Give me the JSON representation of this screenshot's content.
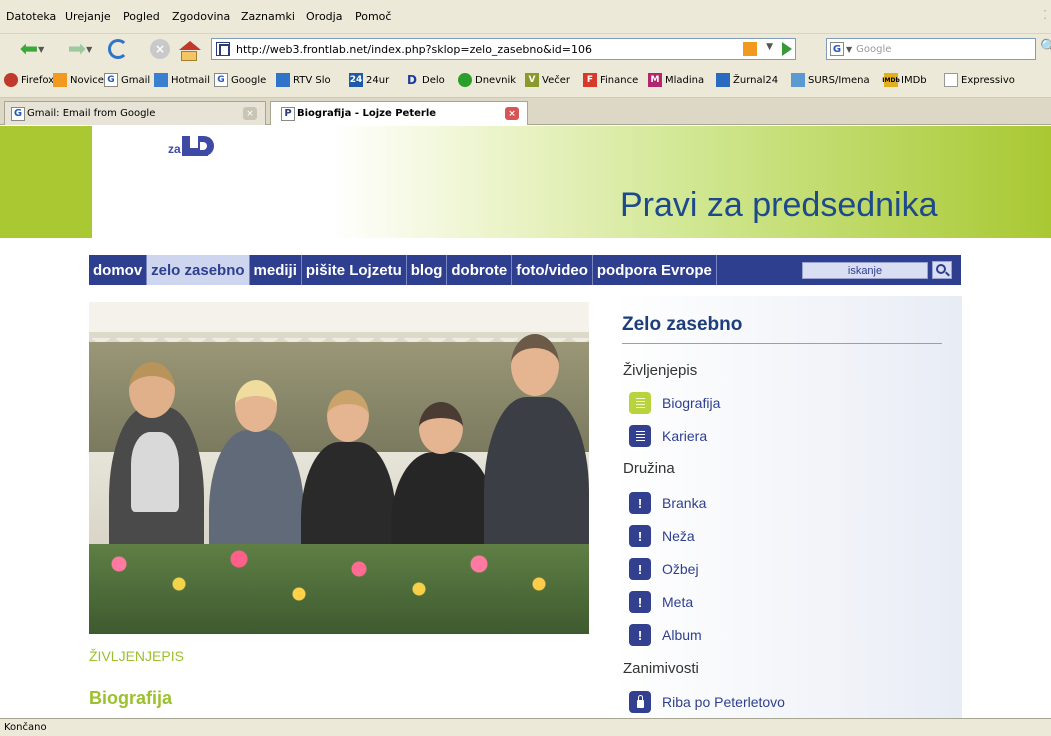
{
  "browser": {
    "menu": [
      "Datoteka",
      "Urejanje",
      "Pogled",
      "Zgodovina",
      "Zaznamki",
      "Orodja",
      "Pomoč"
    ],
    "url": "http://web3.frontlab.net/index.php?sklop=zelo_zasebno&id=106",
    "search_placeholder": "Google",
    "search_engine_icon": "G",
    "bookmarks": [
      {
        "label": "Firefox",
        "icon": "firefox-icon",
        "color": "#c0392b"
      },
      {
        "label": "Novice",
        "icon": "rss-icon",
        "color": "#f29a1f"
      },
      {
        "label": "Gmail",
        "icon": "google-icon",
        "color": "#2559b8"
      },
      {
        "label": "Hotmail",
        "icon": "msn-icon",
        "color": "#3a80d0"
      },
      {
        "label": "Google",
        "icon": "google-icon",
        "color": "#2559b8"
      },
      {
        "label": "RTV Slo",
        "icon": "rtv-icon",
        "color": "#2f74c8"
      },
      {
        "label": "24ur",
        "icon": "24ur-icon",
        "color": "#1e5aa8"
      },
      {
        "label": "Delo",
        "icon": "delo-icon",
        "color": "#1e3aa0"
      },
      {
        "label": "Dnevnik",
        "icon": "dnevnik-icon",
        "color": "#2aa02a"
      },
      {
        "label": "Večer",
        "icon": "vecer-icon",
        "color": "#8a9a2a"
      },
      {
        "label": "Finance",
        "icon": "finance-icon",
        "color": "#d83a2a"
      },
      {
        "label": "Mladina",
        "icon": "mladina-icon",
        "color": "#b3266e"
      },
      {
        "label": "Žurnal24",
        "icon": "zurnal-icon",
        "color": "#2a6ac0"
      },
      {
        "label": "SURS/Imena",
        "icon": "surs-icon",
        "color": "#5a9ad0"
      },
      {
        "label": "IMDb",
        "icon": "imdb-icon",
        "color": "#e0b020"
      },
      {
        "label": "Expressivo",
        "icon": "page-icon",
        "color": "#dddddd"
      }
    ],
    "tabs": [
      {
        "label": "Gmail: Email from Google",
        "icon": "G"
      },
      {
        "label": "Biografija - Lojze Peterle",
        "icon": "P"
      }
    ],
    "status": "Končano"
  },
  "site": {
    "logo_text": "za",
    "slogan": "Pravi za predsednika",
    "nav": [
      "domov",
      "zelo zasebno",
      "mediji",
      "pišite Lojzetu",
      "blog",
      "dobrote",
      "foto/video",
      "podpora Evrope"
    ],
    "nav_active": "zelo zasebno",
    "search_label": "iskanje",
    "breadcrumb": "ŽIVLJENJEPIS",
    "article_title": "Biografija",
    "colors": {
      "green": "#a9c832",
      "navy": "#2e3f8f",
      "title_blue": "#1e3d7b"
    }
  },
  "sidebar": {
    "title": "Zelo zasebno",
    "sections": [
      {
        "heading": "Življenjepis",
        "items": [
          {
            "label": "Biografija",
            "icon": "document-icon",
            "style": "green"
          },
          {
            "label": "Kariera",
            "icon": "document-icon",
            "style": "blue"
          }
        ]
      },
      {
        "heading": "Družina",
        "items": [
          {
            "label": "Branka",
            "icon": "exclamation-icon",
            "style": "blue"
          },
          {
            "label": "Neža",
            "icon": "exclamation-icon",
            "style": "blue"
          },
          {
            "label": "Ožbej",
            "icon": "exclamation-icon",
            "style": "blue"
          },
          {
            "label": "Meta",
            "icon": "exclamation-icon",
            "style": "blue"
          },
          {
            "label": "Album",
            "icon": "exclamation-icon",
            "style": "blue"
          }
        ]
      },
      {
        "heading": "Zanimivosti",
        "items": [
          {
            "label": "Riba po Peterletovo",
            "icon": "lock-icon",
            "style": "blue"
          }
        ]
      }
    ]
  }
}
